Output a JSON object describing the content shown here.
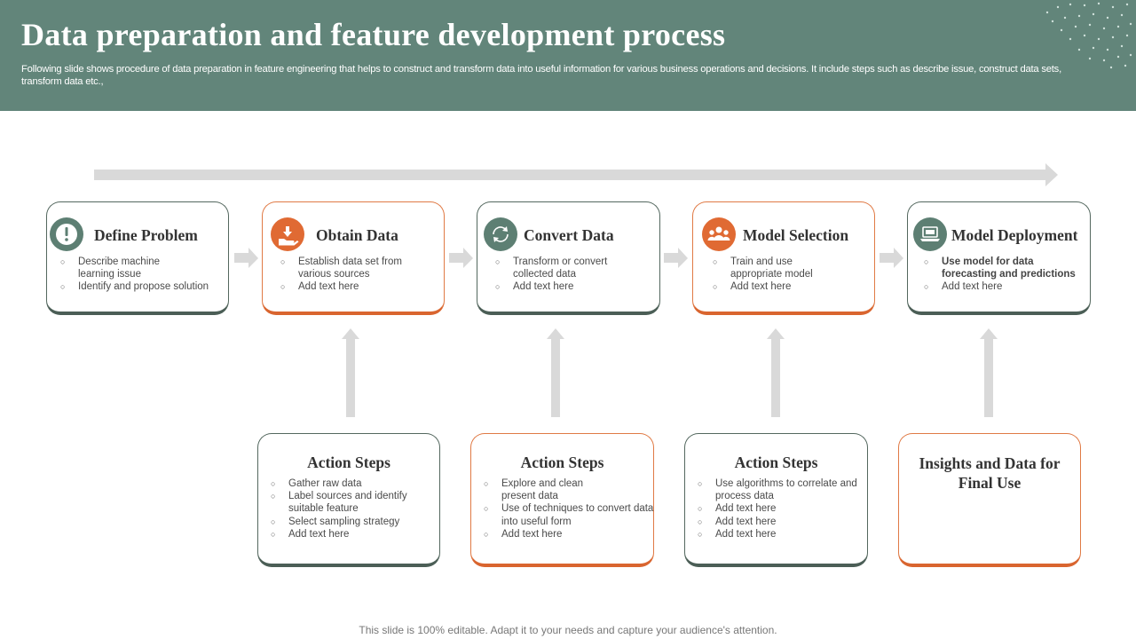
{
  "header": {
    "title": "Data preparation and feature development process",
    "subtitle": "Following slide shows procedure of data preparation in feature engineering that helps to construct and transform data into useful information for various business operations and decisions. It include steps such as describe issue, construct data sets, transform data etc.,"
  },
  "colors": {
    "header_bg": "#62857a",
    "green": "#5d7f73",
    "orange": "#e06a33",
    "arrow": "#d9d9d9"
  },
  "steps": [
    {
      "title": "Define Problem",
      "icon": "exclamation-icon",
      "accent": "green",
      "bullets": [
        "Describe machine learning issue",
        "Identify and propose solution"
      ]
    },
    {
      "title": "Obtain Data",
      "icon": "hand-download-icon",
      "accent": "orange",
      "bullets": [
        "Establish data set from various sources",
        "Add text here"
      ]
    },
    {
      "title": "Convert Data",
      "icon": "cycle-arrows-icon",
      "accent": "green",
      "bullets": [
        "Transform or convert collected data",
        "Add text here"
      ]
    },
    {
      "title": "Model Selection",
      "icon": "team-icon",
      "accent": "orange",
      "bullets": [
        "Train and use appropriate model",
        "Add text here"
      ]
    },
    {
      "title": "Model Deployment",
      "icon": "laptop-icon",
      "accent": "green",
      "bullets": [
        "Use model for data forecasting and predictions",
        "Add text here"
      ]
    }
  ],
  "actions": [
    {
      "title": "Action Steps",
      "bullets": [
        "Gather raw data",
        "Label sources and identify suitable feature",
        "Select sampling strategy",
        "Add text here"
      ]
    },
    {
      "title": "Action Steps",
      "bullets": [
        "Explore and clean present data",
        "Use of techniques to convert data into useful form",
        "Add text here"
      ]
    },
    {
      "title": "Action Steps",
      "bullets": [
        "Use algorithms to correlate and process data",
        "Add text here",
        "Add text here",
        "Add text here"
      ]
    }
  ],
  "final": {
    "title": "Insights and Data for Final Use"
  },
  "footer": "This slide is 100% editable. Adapt it to your needs and capture your audience's attention."
}
